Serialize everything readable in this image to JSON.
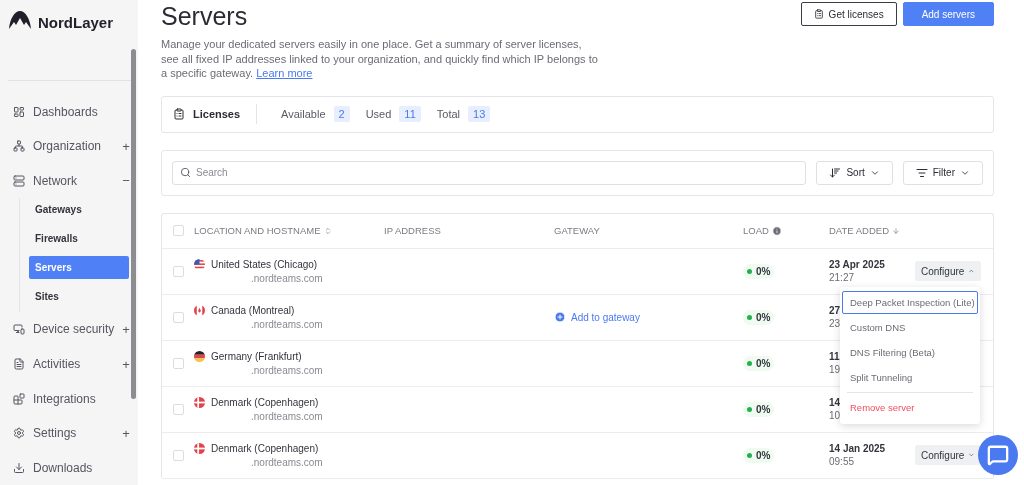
{
  "brand": {
    "name": "NordLayer"
  },
  "sidebar": {
    "items": [
      {
        "label": "Dashboards"
      },
      {
        "label": "Organization",
        "toggle": "+"
      },
      {
        "label": "Network",
        "toggle": "−",
        "expanded": true,
        "children": [
          {
            "label": "Gateways",
            "selected": false
          },
          {
            "label": "Firewalls",
            "selected": false
          },
          {
            "label": "Servers",
            "selected": true
          },
          {
            "label": "Sites",
            "selected": false
          }
        ]
      },
      {
        "label": "Device security",
        "toggle": "+"
      },
      {
        "label": "Activities",
        "toggle": "+"
      },
      {
        "label": "Integrations"
      },
      {
        "label": "Settings",
        "toggle": "+"
      },
      {
        "label": "Downloads"
      }
    ]
  },
  "header": {
    "title": "Servers",
    "description": "Manage your dedicated servers easily in one place. Get a summary of server licenses, see all fixed IP addresses linked to your organization, and quickly find which IP belongs to a specific gateway.",
    "link": "Learn more",
    "buttons": [
      {
        "label": "Get licenses",
        "kind": "outline"
      },
      {
        "label": "Add servers",
        "kind": "primary"
      }
    ]
  },
  "licenses": {
    "label": "Licenses",
    "stats": [
      {
        "label": "Available",
        "value": "2"
      },
      {
        "label": "Used",
        "value": "11"
      },
      {
        "label": "Total",
        "value": "13"
      }
    ]
  },
  "search": {
    "placeholder": "Search"
  },
  "toolbar": [
    {
      "label": "Sort",
      "kind": "sort"
    },
    {
      "label": "Filter",
      "kind": "filter"
    }
  ],
  "table": {
    "select_all": {
      "checked": false
    },
    "columns": [
      "LOCATION AND HOSTNAME",
      "IP ADDRESS",
      "GATEWAY",
      "LOAD",
      "DATE ADDED"
    ],
    "rows": [
      {
        "checked": false,
        "kind": "us",
        "location": "United States (Chicago)",
        "hostname": ".nordteams.com",
        "load": "0%",
        "date": "23 Apr 2025",
        "time": "21:27",
        "action": {
          "label": "Configure",
          "expanded": true
        }
      },
      {
        "checked": false,
        "kind": "ca",
        "location": "Canada (Montreal)",
        "hostname": ".nordteams.com",
        "gateway_link": "Add to gateway",
        "load": "0%",
        "date": "27",
        "time": "23:"
      },
      {
        "checked": false,
        "kind": "de",
        "location": "Germany (Frankfurt)",
        "hostname": ".nordteams.com",
        "load": "0%",
        "date": "11",
        "time": "19:"
      },
      {
        "checked": false,
        "kind": "dk",
        "location": "Denmark (Copenhagen)",
        "hostname": ".nordteams.com",
        "load": "0%",
        "date": "14",
        "time": "10:"
      },
      {
        "checked": false,
        "kind": "dk",
        "location": "Denmark (Copenhagen)",
        "hostname": ".nordteams.com",
        "load": "0%",
        "date": "14 Jan 2025",
        "time": "09:55",
        "action": {
          "label": "Configure",
          "expanded": false
        }
      }
    ]
  },
  "menu": {
    "items": [
      {
        "label": "Deep Packet Inspection (Lite)",
        "kind": "normal",
        "selected": true
      },
      {
        "label": "Custom DNS",
        "kind": "normal",
        "selected": false
      },
      {
        "label": "DNS Filtering (Beta)",
        "kind": "normal",
        "selected": false
      },
      {
        "label": "Split Tunneling",
        "kind": "normal",
        "selected": false
      },
      {
        "label": "Remove server",
        "kind": "danger",
        "selected": false
      }
    ]
  }
}
